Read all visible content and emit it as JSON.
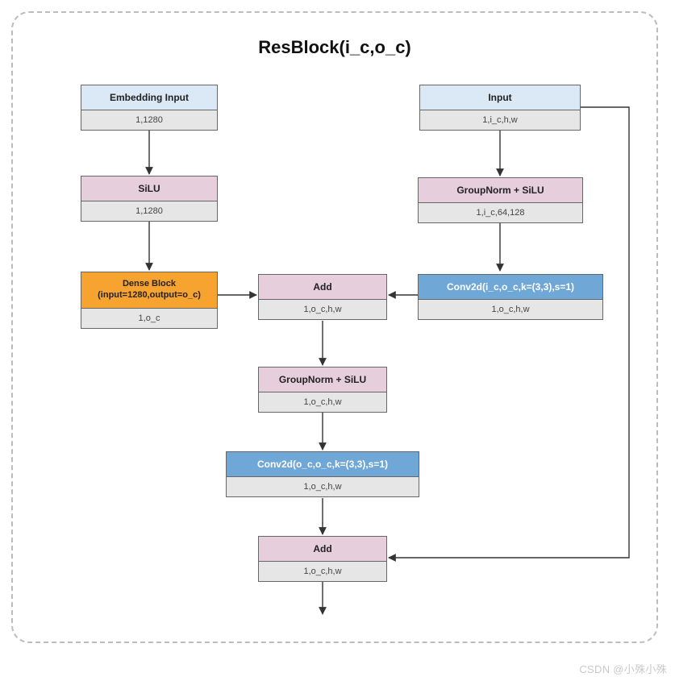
{
  "title": "ResBlock(i_c,o_c)",
  "watermark": "CSDN @小殊小殊",
  "blocks": {
    "emb": {
      "label": "Embedding Input",
      "shape": "1,1280"
    },
    "silu": {
      "label": "SiLU",
      "shape": "1,1280"
    },
    "dense": {
      "label": "Dense Block (input=1280,output=o_c)",
      "shape": "1,o_c"
    },
    "input": {
      "label": "Input",
      "shape": "1,i_c,h,w"
    },
    "gn1": {
      "label": "GroupNorm + SiLU",
      "shape": "1,i_c,64,128"
    },
    "conv1": {
      "label": "Conv2d(i_c,o_c,k=(3,3),s=1)",
      "shape": "1,o_c,h,w"
    },
    "add1": {
      "label": "Add",
      "shape": "1,o_c,h,w"
    },
    "gn2": {
      "label": "GroupNorm + SiLU",
      "shape": "1,o_c,h,w"
    },
    "conv2": {
      "label": "Conv2d(o_c,o_c,k=(3,3),s=1)",
      "shape": "1,o_c,h,w"
    },
    "add2": {
      "label": "Add",
      "shape": "1,o_c,h,w"
    }
  },
  "edges": [
    {
      "from": "emb",
      "to": "silu"
    },
    {
      "from": "silu",
      "to": "dense"
    },
    {
      "from": "dense",
      "to": "add1"
    },
    {
      "from": "input",
      "to": "gn1"
    },
    {
      "from": "gn1",
      "to": "conv1"
    },
    {
      "from": "conv1",
      "to": "add1"
    },
    {
      "from": "add1",
      "to": "gn2"
    },
    {
      "from": "gn2",
      "to": "conv2"
    },
    {
      "from": "conv2",
      "to": "add2"
    },
    {
      "from": "input",
      "to": "add2",
      "note": "skip connection"
    }
  ]
}
